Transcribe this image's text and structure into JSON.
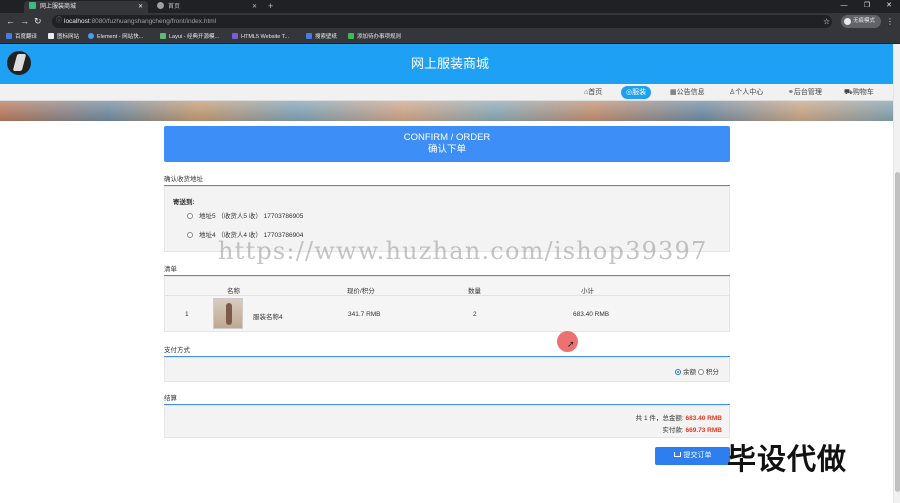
{
  "browser": {
    "tabs": [
      {
        "title": "网上服装商城",
        "active": true
      },
      {
        "title": "首页",
        "active": false
      }
    ],
    "url_host": "localhost",
    "url_rest": ":8080/fuzhuangshangcheng/front/index.html",
    "profile_label": "无痕模式",
    "bookmarks": [
      "百度翻译",
      "图标网站",
      "Element - 网站快...",
      "Layui - 经典开源模...",
      "HTML5 Website T...",
      "搜索壁纸",
      "添加待办事项规则"
    ]
  },
  "site": {
    "title": "网上服装商城",
    "nav": [
      {
        "label": "首页",
        "icon": "home-icon",
        "active": false
      },
      {
        "label": "服装",
        "icon": "tag-icon",
        "active": true
      },
      {
        "label": "公告信息",
        "icon": "notice-icon",
        "active": false
      },
      {
        "label": "个人中心",
        "icon": "user-icon",
        "active": false
      },
      {
        "label": "后台管理",
        "icon": "link-icon",
        "active": false
      },
      {
        "label": "购物车",
        "icon": "cart-icon",
        "active": false
      }
    ]
  },
  "order": {
    "header_en": "CONFIRM / ORDER",
    "header_cn": "确认下单",
    "address_section": "确认收货地址",
    "ship_to_label": "寄送到:",
    "addresses": [
      {
        "text": "地址5 （收货人5 收） 17703786905",
        "selected": false
      },
      {
        "text": "地址4 （收货人4 收） 17703786904",
        "selected": false
      }
    ],
    "list_section": "清单",
    "table_headers": [
      "名称",
      "现价/积分",
      "数量",
      "小计"
    ],
    "rows": [
      {
        "index": "1",
        "name": "服装名称4",
        "price": "341.7 RMB",
        "qty": "2",
        "subtotal": "683.40 RMB"
      }
    ],
    "payment_section": "支付方式",
    "payment_options": [
      {
        "label": "余额",
        "selected": true
      },
      {
        "label": "积分",
        "selected": false
      }
    ],
    "settle_section": "结算",
    "summary_prefix": "共 1 件，总金额:",
    "total": "683.40 RMB",
    "actual_label": "实付款:",
    "actual": "669.73 RMB",
    "submit_label": "提交订单"
  },
  "overlays": {
    "watermark": "https://www.huzhan.com/ishop39397",
    "promo": "毕设代做"
  },
  "colors": {
    "header_blue": "#1ea0f5",
    "accent": "#3e8ef7",
    "price_red": "#e03b1e"
  }
}
